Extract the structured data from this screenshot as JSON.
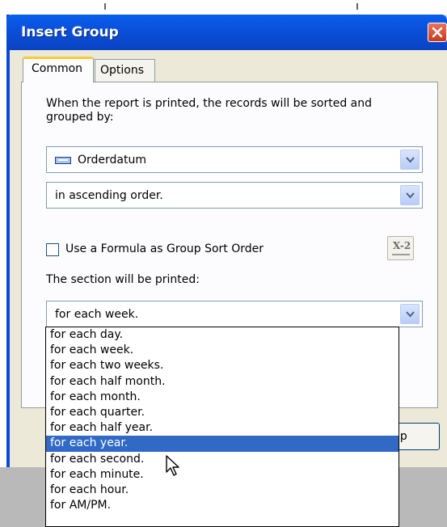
{
  "window": {
    "title": "Insert Group"
  },
  "tabs": [
    {
      "label": "Common",
      "active": true
    },
    {
      "label": "Options",
      "active": false
    }
  ],
  "description": "When the report is printed, the records will be sorted and grouped by:",
  "group_field": {
    "value": "Orderdatum",
    "icon": "field-icon"
  },
  "sort_order": {
    "value": "in ascending order."
  },
  "formula_checkbox": {
    "label": "Use a Formula as Group Sort Order",
    "checked": false
  },
  "formula_button": {
    "label": "X-2"
  },
  "section_label": "The section will be printed:",
  "interval": {
    "value": "for each week."
  },
  "interval_options": [
    "for each day.",
    "for each week.",
    "for each two weeks.",
    "for each half month.",
    "for each month.",
    "for each quarter.",
    "for each half year.",
    "for each year.",
    "for each second.",
    "for each minute.",
    "for each hour.",
    "for AM/PM."
  ],
  "highlighted_option": "for each year.",
  "help_button": {
    "label": "lp"
  },
  "colors": {
    "title_bar": "#0b4fd8",
    "selection": "#316ac5",
    "tab_accent": "#ffc83c"
  }
}
